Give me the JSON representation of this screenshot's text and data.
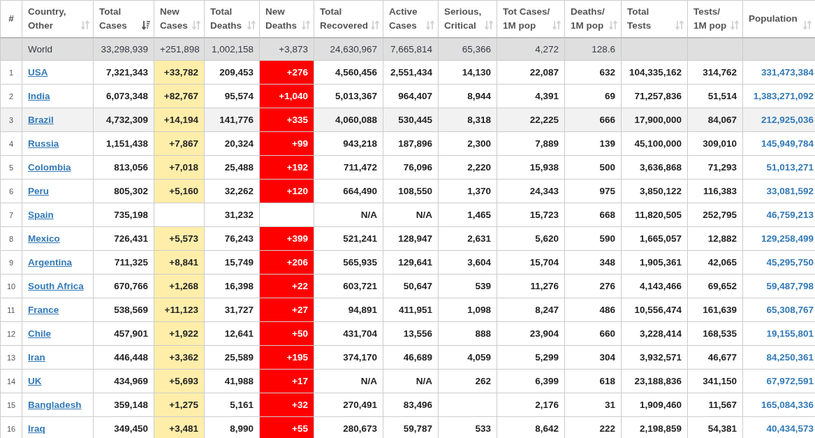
{
  "table": {
    "columns": [
      {
        "label": "#"
      },
      {
        "label": "Country,\nOther",
        "sortable": true,
        "sorted": false
      },
      {
        "label": "Total\nCases",
        "sortable": true,
        "sorted": true
      },
      {
        "label": "New\nCases",
        "sortable": true,
        "sorted": false
      },
      {
        "label": "Total\nDeaths",
        "sortable": true,
        "sorted": false
      },
      {
        "label": "New\nDeaths",
        "sortable": true,
        "sorted": false
      },
      {
        "label": "Total\nRecovered",
        "sortable": true,
        "sorted": false
      },
      {
        "label": "Active\nCases",
        "sortable": true,
        "sorted": false
      },
      {
        "label": "Serious,\nCritical",
        "sortable": true,
        "sorted": false
      },
      {
        "label": "Tot Cases/\n1M pop",
        "sortable": true,
        "sorted": false
      },
      {
        "label": "Deaths/\n1M pop",
        "sortable": true,
        "sorted": false
      },
      {
        "label": "Total\nTests",
        "sortable": true,
        "sorted": false
      },
      {
        "label": "Tests/\n1M pop",
        "sortable": true,
        "sorted": false
      },
      {
        "label": "Population",
        "sortable": true,
        "sorted": false
      }
    ],
    "world_row": {
      "country": "World",
      "total_cases": "33,298,939",
      "new_cases": "+251,898",
      "total_deaths": "1,002,158",
      "new_deaths": "+3,873",
      "total_recovered": "24,630,967",
      "active_cases": "7,665,814",
      "serious_critical": "65,366",
      "cases_per_1m": "4,272",
      "deaths_per_1m": "128.6"
    },
    "rows": [
      {
        "rank": "1",
        "country": "USA",
        "total_cases": "7,321,343",
        "new_cases": "+33,782",
        "total_deaths": "209,453",
        "new_deaths": "+276",
        "total_recovered": "4,560,456",
        "active_cases": "2,551,434",
        "serious_critical": "14,130",
        "cases_per_1m": "22,087",
        "deaths_per_1m": "632",
        "total_tests": "104,335,162",
        "tests_per_1m": "314,762",
        "population": "331,473,384",
        "selected": false
      },
      {
        "rank": "2",
        "country": "India",
        "total_cases": "6,073,348",
        "new_cases": "+82,767",
        "total_deaths": "95,574",
        "new_deaths": "+1,040",
        "total_recovered": "5,013,367",
        "active_cases": "964,407",
        "serious_critical": "8,944",
        "cases_per_1m": "4,391",
        "deaths_per_1m": "69",
        "total_tests": "71,257,836",
        "tests_per_1m": "51,514",
        "population": "1,383,271,092",
        "selected": false
      },
      {
        "rank": "3",
        "country": "Brazil",
        "total_cases": "4,732,309",
        "new_cases": "+14,194",
        "total_deaths": "141,776",
        "new_deaths": "+335",
        "total_recovered": "4,060,088",
        "active_cases": "530,445",
        "serious_critical": "8,318",
        "cases_per_1m": "22,225",
        "deaths_per_1m": "666",
        "total_tests": "17,900,000",
        "tests_per_1m": "84,067",
        "population": "212,925,036",
        "selected": true
      },
      {
        "rank": "4",
        "country": "Russia",
        "total_cases": "1,151,438",
        "new_cases": "+7,867",
        "total_deaths": "20,324",
        "new_deaths": "+99",
        "total_recovered": "943,218",
        "active_cases": "187,896",
        "serious_critical": "2,300",
        "cases_per_1m": "7,889",
        "deaths_per_1m": "139",
        "total_tests": "45,100,000",
        "tests_per_1m": "309,010",
        "population": "145,949,784",
        "selected": false
      },
      {
        "rank": "5",
        "country": "Colombia",
        "total_cases": "813,056",
        "new_cases": "+7,018",
        "total_deaths": "25,488",
        "new_deaths": "+192",
        "total_recovered": "711,472",
        "active_cases": "76,096",
        "serious_critical": "2,220",
        "cases_per_1m": "15,938",
        "deaths_per_1m": "500",
        "total_tests": "3,636,868",
        "tests_per_1m": "71,293",
        "population": "51,013,271",
        "selected": false
      },
      {
        "rank": "6",
        "country": "Peru",
        "total_cases": "805,302",
        "new_cases": "+5,160",
        "total_deaths": "32,262",
        "new_deaths": "+120",
        "total_recovered": "664,490",
        "active_cases": "108,550",
        "serious_critical": "1,370",
        "cases_per_1m": "24,343",
        "deaths_per_1m": "975",
        "total_tests": "3,850,122",
        "tests_per_1m": "116,383",
        "population": "33,081,592",
        "selected": false
      },
      {
        "rank": "7",
        "country": "Spain",
        "total_cases": "735,198",
        "total_deaths": "31,232",
        "total_recovered": "N/A",
        "active_cases": "N/A",
        "serious_critical": "1,465",
        "cases_per_1m": "15,723",
        "deaths_per_1m": "668",
        "total_tests": "11,820,505",
        "tests_per_1m": "252,795",
        "population": "46,759,213",
        "selected": false
      },
      {
        "rank": "8",
        "country": "Mexico",
        "total_cases": "726,431",
        "new_cases": "+5,573",
        "total_deaths": "76,243",
        "new_deaths": "+399",
        "total_recovered": "521,241",
        "active_cases": "128,947",
        "serious_critical": "2,631",
        "cases_per_1m": "5,620",
        "deaths_per_1m": "590",
        "total_tests": "1,665,057",
        "tests_per_1m": "12,882",
        "population": "129,258,499",
        "selected": false
      },
      {
        "rank": "9",
        "country": "Argentina",
        "total_cases": "711,325",
        "new_cases": "+8,841",
        "total_deaths": "15,749",
        "new_deaths": "+206",
        "total_recovered": "565,935",
        "active_cases": "129,641",
        "serious_critical": "3,604",
        "cases_per_1m": "15,704",
        "deaths_per_1m": "348",
        "total_tests": "1,905,361",
        "tests_per_1m": "42,065",
        "population": "45,295,750",
        "selected": false
      },
      {
        "rank": "10",
        "country": "South Africa",
        "total_cases": "670,766",
        "new_cases": "+1,268",
        "total_deaths": "16,398",
        "new_deaths": "+22",
        "total_recovered": "603,721",
        "active_cases": "50,647",
        "serious_critical": "539",
        "cases_per_1m": "11,276",
        "deaths_per_1m": "276",
        "total_tests": "4,143,466",
        "tests_per_1m": "69,652",
        "population": "59,487,798",
        "selected": false
      },
      {
        "rank": "11",
        "country": "France",
        "total_cases": "538,569",
        "new_cases": "+11,123",
        "total_deaths": "31,727",
        "new_deaths": "+27",
        "total_recovered": "94,891",
        "active_cases": "411,951",
        "serious_critical": "1,098",
        "cases_per_1m": "8,247",
        "deaths_per_1m": "486",
        "total_tests": "10,556,474",
        "tests_per_1m": "161,639",
        "population": "65,308,767",
        "selected": false
      },
      {
        "rank": "12",
        "country": "Chile",
        "total_cases": "457,901",
        "new_cases": "+1,922",
        "total_deaths": "12,641",
        "new_deaths": "+50",
        "total_recovered": "431,704",
        "active_cases": "13,556",
        "serious_critical": "888",
        "cases_per_1m": "23,904",
        "deaths_per_1m": "660",
        "total_tests": "3,228,414",
        "tests_per_1m": "168,535",
        "population": "19,155,801",
        "selected": false
      },
      {
        "rank": "13",
        "country": "Iran",
        "total_cases": "446,448",
        "new_cases": "+3,362",
        "total_deaths": "25,589",
        "new_deaths": "+195",
        "total_recovered": "374,170",
        "active_cases": "46,689",
        "serious_critical": "4,059",
        "cases_per_1m": "5,299",
        "deaths_per_1m": "304",
        "total_tests": "3,932,571",
        "tests_per_1m": "46,677",
        "population": "84,250,361",
        "selected": false
      },
      {
        "rank": "14",
        "country": "UK",
        "total_cases": "434,969",
        "new_cases": "+5,693",
        "total_deaths": "41,988",
        "new_deaths": "+17",
        "total_recovered": "N/A",
        "active_cases": "N/A",
        "serious_critical": "262",
        "cases_per_1m": "6,399",
        "deaths_per_1m": "618",
        "total_tests": "23,188,836",
        "tests_per_1m": "341,150",
        "population": "67,972,591",
        "selected": false
      },
      {
        "rank": "15",
        "country": "Bangladesh",
        "total_cases": "359,148",
        "new_cases": "+1,275",
        "total_deaths": "5,161",
        "new_deaths": "+32",
        "total_recovered": "270,491",
        "active_cases": "83,496",
        "cases_per_1m": "2,176",
        "deaths_per_1m": "31",
        "total_tests": "1,909,460",
        "tests_per_1m": "11,567",
        "population": "165,084,336",
        "selected": false
      },
      {
        "rank": "16",
        "country": "Iraq",
        "total_cases": "349,450",
        "new_cases": "+3,481",
        "total_deaths": "8,990",
        "new_deaths": "+55",
        "total_recovered": "280,673",
        "active_cases": "59,787",
        "serious_critical": "533",
        "cases_per_1m": "8,642",
        "deaths_per_1m": "222",
        "total_tests": "2,198,859",
        "tests_per_1m": "54,381",
        "population": "40,434,573",
        "selected": false
      }
    ]
  }
}
